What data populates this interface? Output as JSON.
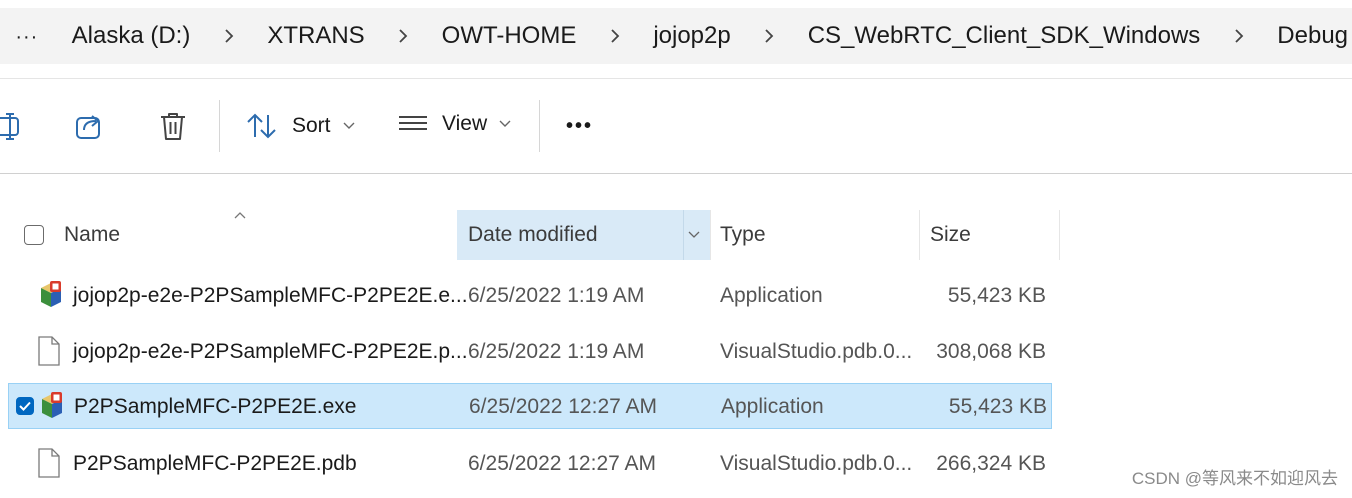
{
  "breadcrumb": {
    "more_label": "···",
    "items": [
      "Alaska (D:)",
      "XTRANS",
      "OWT-HOME",
      "jojop2p",
      "CS_WebRTC_Client_SDK_Windows",
      "Debug"
    ]
  },
  "toolbar": {
    "sort_label": "Sort",
    "view_label": "View",
    "more_label": "•••"
  },
  "columns": {
    "name": "Name",
    "date": "Date modified",
    "type": "Type",
    "size": "Size"
  },
  "files": [
    {
      "name": "jojop2p-e2e-P2PSampleMFC-P2PE2E.e...",
      "date": "6/25/2022 1:19 AM",
      "type": "Application",
      "size": "55,423 KB",
      "icon": "application-icon",
      "selected": false
    },
    {
      "name": "jojop2p-e2e-P2PSampleMFC-P2PE2E.p...",
      "date": "6/25/2022 1:19 AM",
      "type": "VisualStudio.pdb.0...",
      "size": "308,068 KB",
      "icon": "document-icon",
      "selected": false
    },
    {
      "name": "P2PSampleMFC-P2PE2E.exe",
      "date": "6/25/2022 12:27 AM",
      "type": "Application",
      "size": "55,423 KB",
      "icon": "application-icon",
      "selected": true
    },
    {
      "name": "P2PSampleMFC-P2PE2E.pdb",
      "date": "6/25/2022 12:27 AM",
      "type": "VisualStudio.pdb.0...",
      "size": "266,324 KB",
      "icon": "document-icon",
      "selected": false
    }
  ],
  "watermark": "CSDN @等风来不如迎风去",
  "colors": {
    "selection_bg": "#cce8fb",
    "sorted_column_bg": "#d9eaf7",
    "checkbox_checked": "#0067c0"
  }
}
